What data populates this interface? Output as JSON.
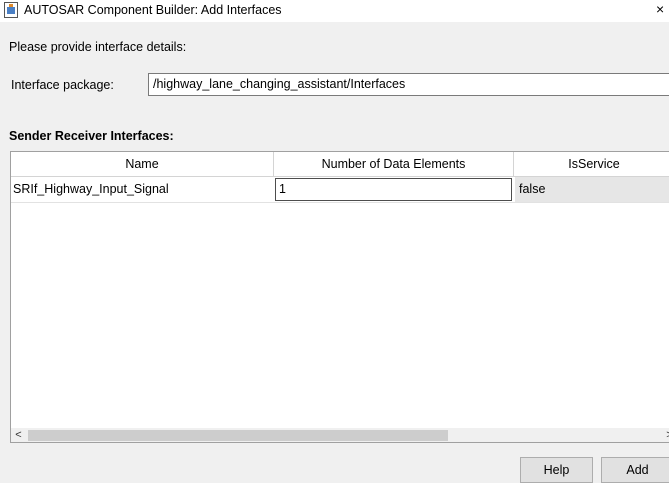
{
  "window": {
    "title": "AUTOSAR Component Builder: Add Interfaces",
    "close_glyph": "×"
  },
  "prompt": "Please provide interface details:",
  "interface_package": {
    "label": "Interface package:",
    "value": "/highway_lane_changing_assistant/Interfaces"
  },
  "sender_receiver": {
    "title": "Sender Receiver Interfaces:",
    "columns": [
      "Name",
      "Number of Data Elements",
      "IsService"
    ],
    "rows": [
      {
        "name": "SRIf_Highway_Input_Signal",
        "num_data_elements": "1",
        "is_service": "false"
      }
    ]
  },
  "scrollbar": {
    "left_glyph": "<",
    "right_glyph": ">"
  },
  "buttons": {
    "help": "Help",
    "add": "Add"
  }
}
